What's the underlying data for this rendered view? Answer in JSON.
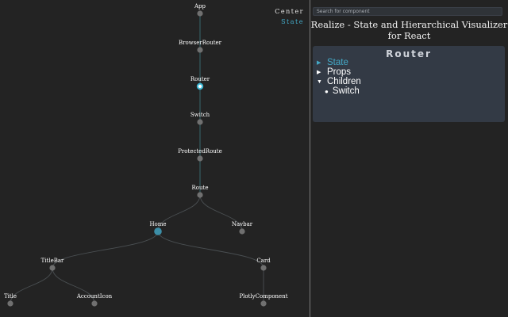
{
  "tree": {
    "view_toggle": {
      "center": "Center",
      "state": "State"
    },
    "nodes": [
      {
        "name": "App"
      },
      {
        "name": "BrowserRouter"
      },
      {
        "name": "Router"
      },
      {
        "name": "Switch"
      },
      {
        "name": "ProtectedRoute"
      },
      {
        "name": "Route"
      },
      {
        "name": "Home"
      },
      {
        "name": "Navbar"
      },
      {
        "name": "TitleBar"
      },
      {
        "name": "Card"
      },
      {
        "name": "Title"
      },
      {
        "name": "AccountIcon"
      },
      {
        "name": "PlotlyComponent"
      }
    ],
    "selected_node": "Router",
    "highlighted_node": "Home"
  },
  "sidebar": {
    "search_placeholder": "Search for component",
    "title": "Realize - State and Hierarchical Visualizer\nfor React",
    "component": {
      "name": "Router",
      "sections": [
        {
          "label": "State",
          "caret": "▶",
          "highlight": true
        },
        {
          "label": "Props",
          "caret": "▶",
          "highlight": false
        },
        {
          "label": "Children",
          "caret": "▼",
          "highlight": false
        }
      ],
      "children": [
        "Switch"
      ]
    }
  },
  "colors": {
    "background": "#232323",
    "accent": "#44a9c7",
    "card": "#333a45",
    "node": "#707070"
  }
}
